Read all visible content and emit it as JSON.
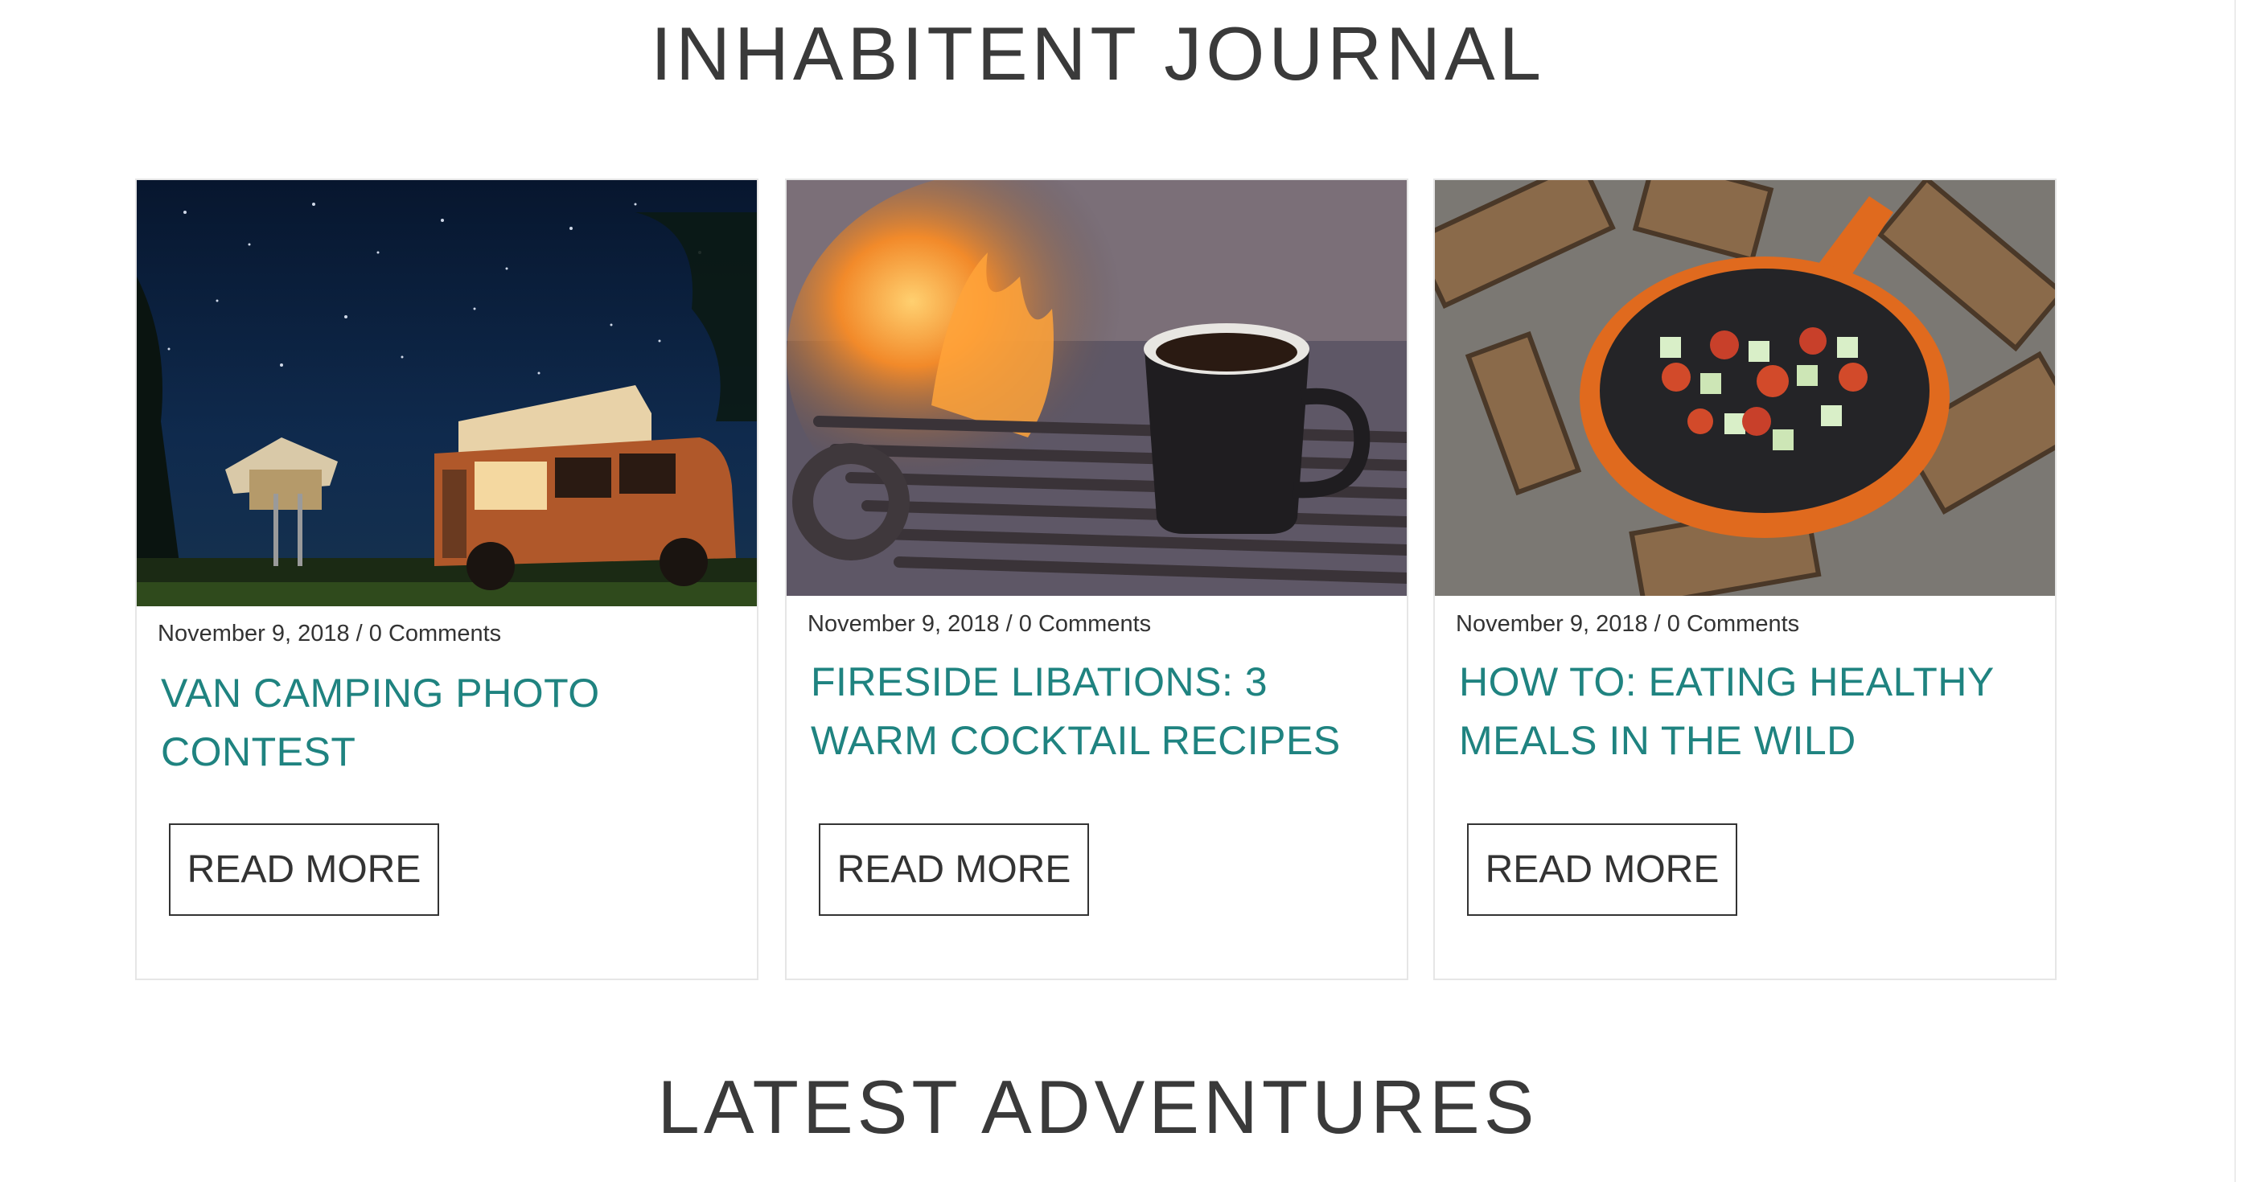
{
  "journal": {
    "heading": "INHABITENT JOURNAL",
    "posts": [
      {
        "image": "van-camping-night-photo",
        "date": "November 9, 2018",
        "comments": "0 Comments",
        "meta": "November 9, 2018 / 0 Comments",
        "title": "VAN CAMPING PHOTO CONTEST",
        "button_label": "READ MORE"
      },
      {
        "image": "coffee-mug-on-fire-grill-photo",
        "date": "November 9, 2018",
        "comments": "0 Comments",
        "meta": "November 9, 2018 / 0 Comments",
        "title": "FIRESIDE LIBATIONS: 3 WARM COCKTAIL RECIPES",
        "button_label": "READ MORE"
      },
      {
        "image": "skillet-cooking-on-campfire-photo",
        "date": "November 9, 2018",
        "comments": "0 Comments",
        "meta": "November 9, 2018 / 0 Comments",
        "title": "HOW TO: EATING HEALTHY MEALS IN THE WILD",
        "button_label": "READ MORE"
      }
    ]
  },
  "adventures": {
    "heading": "LATEST ADVENTURES"
  },
  "colors": {
    "title_accent": "#1f8380",
    "text": "#333333",
    "card_border": "#e6e6e6"
  }
}
